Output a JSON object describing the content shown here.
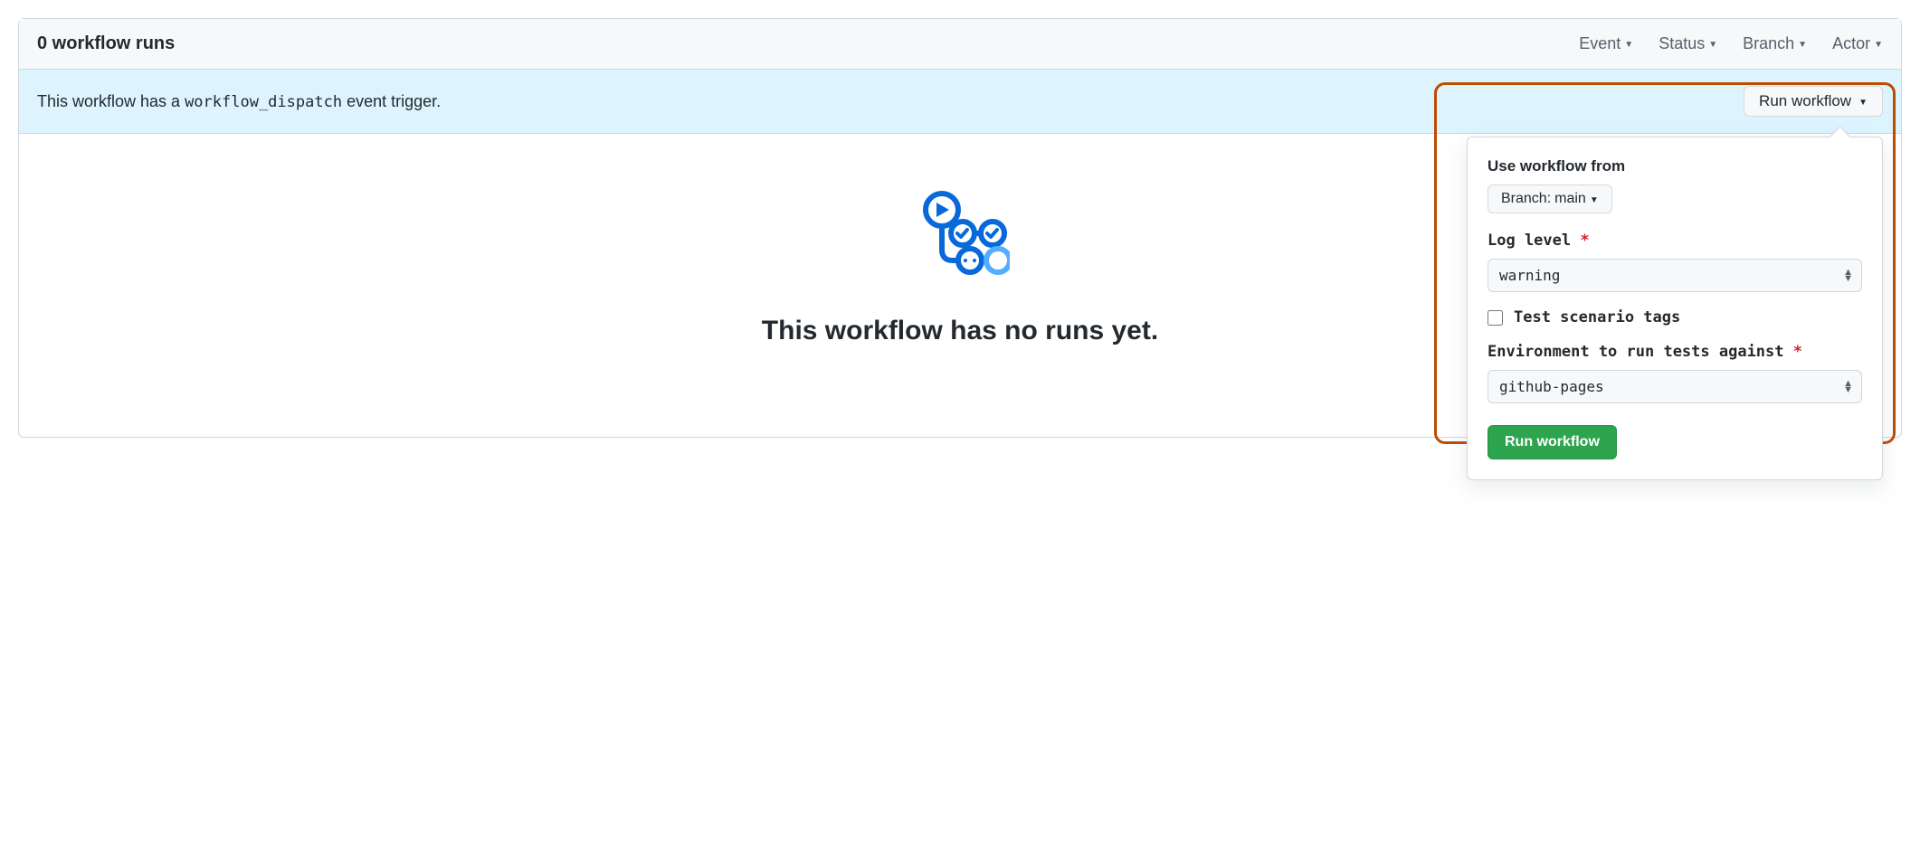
{
  "header": {
    "runs_count": "0 workflow runs",
    "filters": {
      "event": "Event",
      "status": "Status",
      "branch": "Branch",
      "actor": "Actor"
    }
  },
  "banner": {
    "prefix": "This workflow has a ",
    "code": "workflow_dispatch",
    "suffix": " event trigger.",
    "run_btn": "Run workflow"
  },
  "empty": {
    "title": "This workflow has no runs yet."
  },
  "panel": {
    "use_from_label": "Use workflow from",
    "branch_prefix": "Branch: ",
    "branch_value": "main",
    "log_level_label": "Log level",
    "log_level_value": "warning",
    "checkbox_label": "Test scenario tags",
    "env_label": "Environment to run tests against",
    "env_value": "github-pages",
    "submit": "Run workflow"
  }
}
